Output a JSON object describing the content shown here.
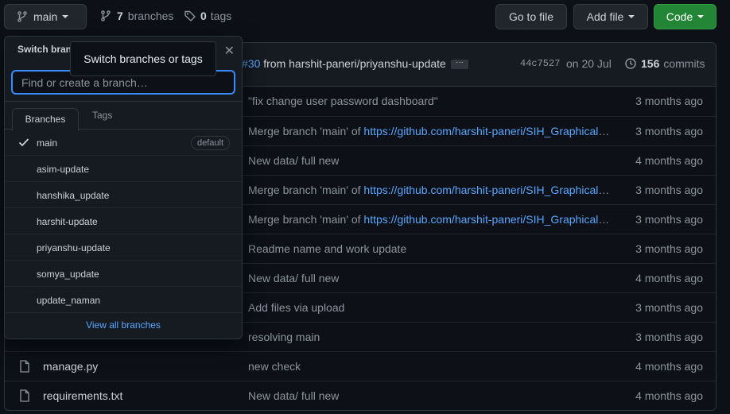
{
  "toolbar": {
    "branch_button_label": "main",
    "branch_count": "7",
    "branches_word": "branches",
    "tag_count": "0",
    "tags_word": "tags",
    "goto_file": "Go to file",
    "add_file": "Add file",
    "code": "Code"
  },
  "commit_header": {
    "pr_number": "#30",
    "message_rest": " from harshit-paneri/priyanshu-update",
    "sha": "44c7527",
    "date": "on 20 Jul",
    "commit_count": "156",
    "commits_word": "commits"
  },
  "files": [
    {
      "name": "",
      "message": "\"fix change user password dashboard\"",
      "link": "",
      "age": "3 months ago"
    },
    {
      "name": "",
      "message": "Merge branch 'main' of ",
      "link": "https://github.com/harshit-paneri/SIH_Graphical_Password_Authentication",
      "age": "3 months ago"
    },
    {
      "name": "",
      "message": "New data/ full new",
      "link": "",
      "age": "4 months ago"
    },
    {
      "name": "",
      "message": "Merge branch 'main' of ",
      "link": "https://github.com/harshit-paneri/SIH_Graphical_Password_Authentication",
      "age": "3 months ago"
    },
    {
      "name": "",
      "message": "Merge branch 'main' of ",
      "link": "https://github.com/harshit-paneri/SIH_Graphical_Password_Authentication",
      "age": "3 months ago"
    },
    {
      "name": "",
      "message": "Readme name and work update",
      "link": "",
      "age": "3 months ago"
    },
    {
      "name": "",
      "message": "New data/ full new",
      "link": "",
      "age": "4 months ago"
    },
    {
      "name": "",
      "message": "Add files via upload",
      "link": "",
      "age": "3 months ago"
    },
    {
      "name": "",
      "message": "resolving main",
      "link": "",
      "age": "3 months ago"
    },
    {
      "name": "manage.py",
      "message": "new check",
      "link": "",
      "age": "4 months ago"
    },
    {
      "name": "requirements.txt",
      "message": "New data/ full new",
      "link": "",
      "age": "4 months ago"
    }
  ],
  "dropdown": {
    "title": "Switch branches/tags",
    "search_placeholder": "Find or create a branch…",
    "tab_branches": "Branches",
    "tab_tags": "Tags",
    "branches": [
      {
        "name": "main",
        "checked": true,
        "badge": "default"
      },
      {
        "name": "asim-update",
        "checked": false,
        "badge": ""
      },
      {
        "name": "hanshika_update",
        "checked": false,
        "badge": ""
      },
      {
        "name": "harshit-update",
        "checked": false,
        "badge": ""
      },
      {
        "name": "priyanshu-update",
        "checked": false,
        "badge": ""
      },
      {
        "name": "somya_update",
        "checked": false,
        "badge": ""
      },
      {
        "name": "update_naman",
        "checked": false,
        "badge": ""
      }
    ],
    "view_all": "View all branches"
  },
  "tooltip": {
    "text": "Switch branches or tags"
  },
  "colors": {
    "background": "#0d1117",
    "accent_blue": "#58a6ff",
    "code_green": "#238636"
  },
  "icons": [
    "git-branch-icon",
    "caret-down-icon",
    "tag-icon",
    "history-icon",
    "close-icon",
    "check-icon",
    "file-icon"
  ]
}
